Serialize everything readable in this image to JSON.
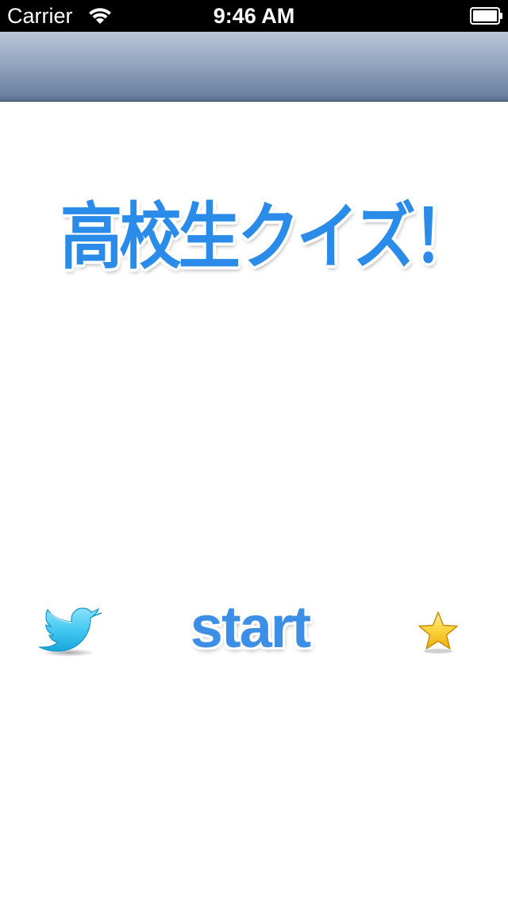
{
  "status_bar": {
    "carrier": "Carrier",
    "time": "9:46 AM",
    "wifi_icon": "wifi-icon",
    "battery_icon": "battery-icon"
  },
  "nav_bar": {
    "title": ""
  },
  "main": {
    "title": "高校生クイズ！",
    "start_label": "start",
    "twitter_icon": "twitter-bird-icon",
    "favorite_icon": "star-icon"
  },
  "colors": {
    "accent_blue": "#2a8ce8",
    "start_blue": "#3d8fe6",
    "twitter_blue": "#3fc5f0",
    "star_yellow": "#f7c21b",
    "nav_top": "#b9c6d8",
    "nav_bottom": "#5a6f8e"
  }
}
